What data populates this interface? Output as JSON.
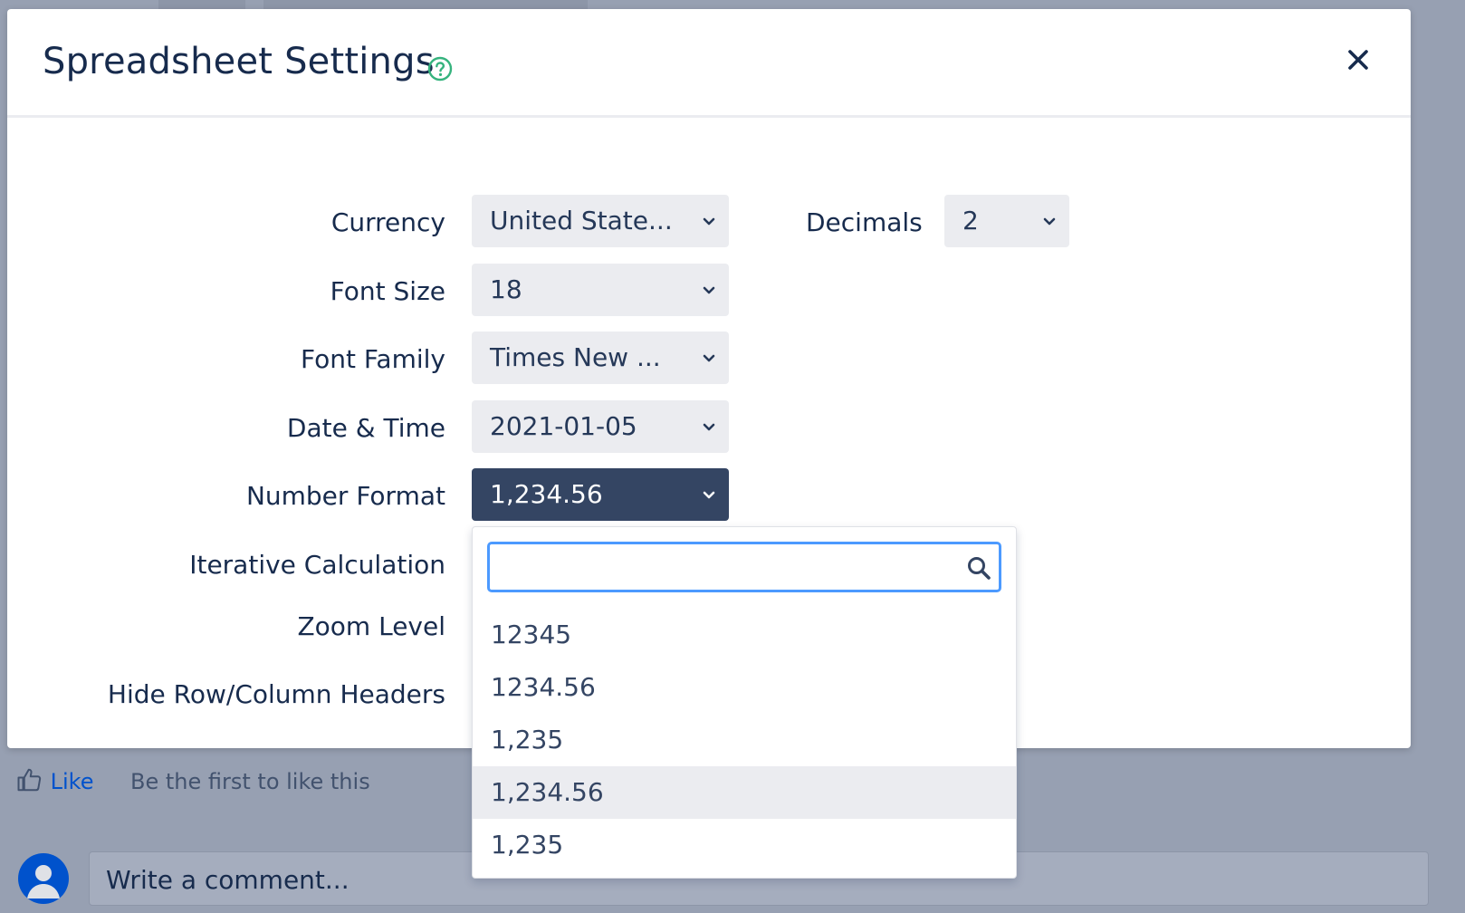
{
  "dialog": {
    "title": "Spreadsheet Settings",
    "help_icon": "help-circle-icon",
    "close_icon": "close-icon"
  },
  "settings": {
    "currency": {
      "label": "Currency",
      "value": "United State..."
    },
    "decimals": {
      "label": "Decimals",
      "value": "2"
    },
    "font_size": {
      "label": "Font Size",
      "value": "18"
    },
    "font_family": {
      "label": "Font Family",
      "value": "Times New ..."
    },
    "date_time": {
      "label": "Date & Time",
      "value": "2021-01-05"
    },
    "number_format": {
      "label": "Number Format",
      "value": "1,234.56"
    },
    "iterative_calculation": {
      "label": "Iterative Calculation"
    },
    "zoom_level": {
      "label": "Zoom Level"
    },
    "hide_headers": {
      "label": "Hide Row/Column Headers"
    }
  },
  "number_format_dropdown": {
    "search_value": "",
    "options": [
      {
        "label": "12345",
        "selected": false
      },
      {
        "label": "1234.56",
        "selected": false
      },
      {
        "label": "1,235",
        "selected": false
      },
      {
        "label": "1,234.56",
        "selected": true
      },
      {
        "label": "1,235",
        "selected": false
      }
    ]
  },
  "page": {
    "like_label": "Like",
    "like_text": "Be the first to like this",
    "comment_placeholder": "Write a comment..."
  },
  "colors": {
    "accent": "#0052cc",
    "help_icon": "#36b37e",
    "open_select": "#344563",
    "focus_ring": "#4c9aff"
  }
}
